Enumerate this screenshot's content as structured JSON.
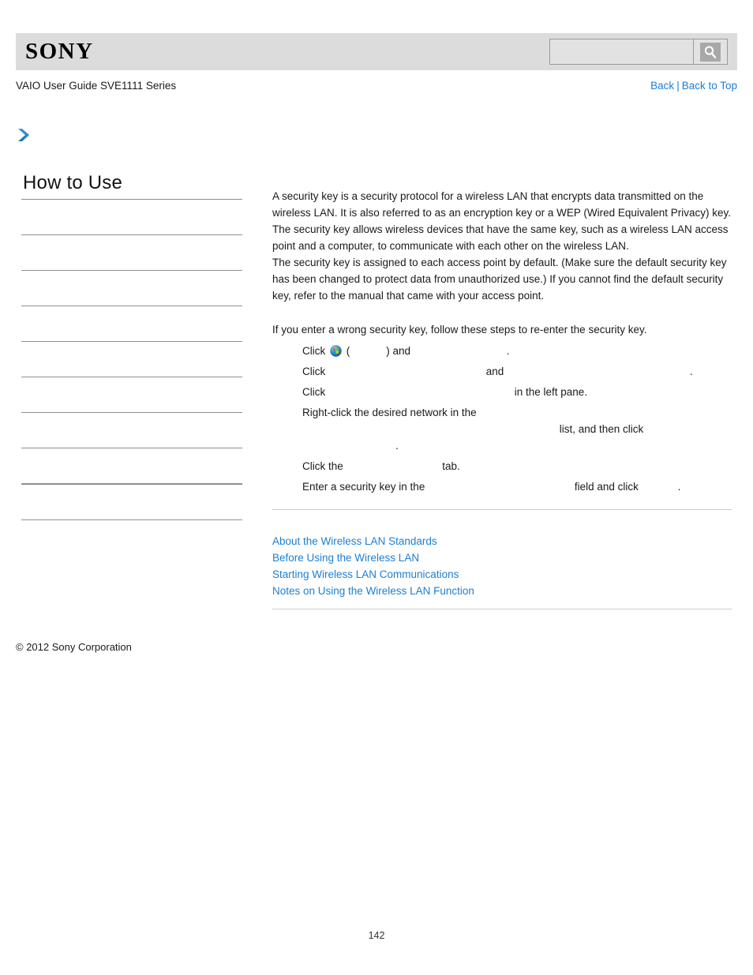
{
  "header": {
    "logo_text": "SONY",
    "search": {
      "value": "",
      "placeholder": "",
      "button_icon": "search-icon"
    }
  },
  "subheader": {
    "guide_title": "VAIO User Guide SVE1111 Series",
    "back_label": "Back",
    "separator": "|",
    "back_to_top_label": "Back to Top"
  },
  "breadcrumb": {
    "icon": "chevron-right-icon"
  },
  "sidebar": {
    "title": "How to Use",
    "items": [
      {
        "label": ""
      },
      {
        "label": ""
      },
      {
        "label": ""
      },
      {
        "label": ""
      },
      {
        "label": ""
      },
      {
        "label": ""
      },
      {
        "label": ""
      },
      {
        "label": ""
      },
      {
        "label": ""
      }
    ]
  },
  "content": {
    "paragraphs": [
      "A security key is a security protocol for a wireless LAN that encrypts data transmitted on the wireless LAN. It is also referred to as an encryption key or a WEP (Wired Equivalent Privacy) key.",
      "The security key allows wireless devices that have the same key, such as a wireless LAN access point and a computer, to communicate with each other on the wireless LAN.",
      "The security key is assigned to each access point by default. (Make sure the default security key has been changed to protect data from unauthorized use.) If you cannot find the default security key, refer to the manual that came with your access point."
    ],
    "steps_lead": "If you enter a wrong security key, follow these steps to re-enter the security key.",
    "steps": [
      {
        "icon": "windows-start-orb-icon",
        "parts": [
          "Click ",
          " (",
          ") and ",
          "."
        ]
      },
      {
        "parts": [
          "Click ",
          " and ",
          "."
        ]
      },
      {
        "parts": [
          "Click ",
          " in the left pane."
        ]
      },
      {
        "parts": [
          "Right-click the desired network in the ",
          " list, and then click ",
          "."
        ]
      },
      {
        "parts": [
          "Click the ",
          " tab."
        ]
      },
      {
        "parts": [
          "Enter a security key in the ",
          " field and click ",
          "."
        ]
      }
    ]
  },
  "related_links": [
    "About the Wireless LAN Standards",
    "Before Using the Wireless LAN",
    "Starting Wireless LAN Communications",
    "Notes on Using the Wireless LAN Function"
  ],
  "footer": {
    "copyright": "© 2012 Sony Corporation",
    "page_number": "142"
  },
  "colors": {
    "link": "#1b7fd4",
    "header_bar": "#dcdcdc",
    "rule": "#8f8f8f"
  }
}
